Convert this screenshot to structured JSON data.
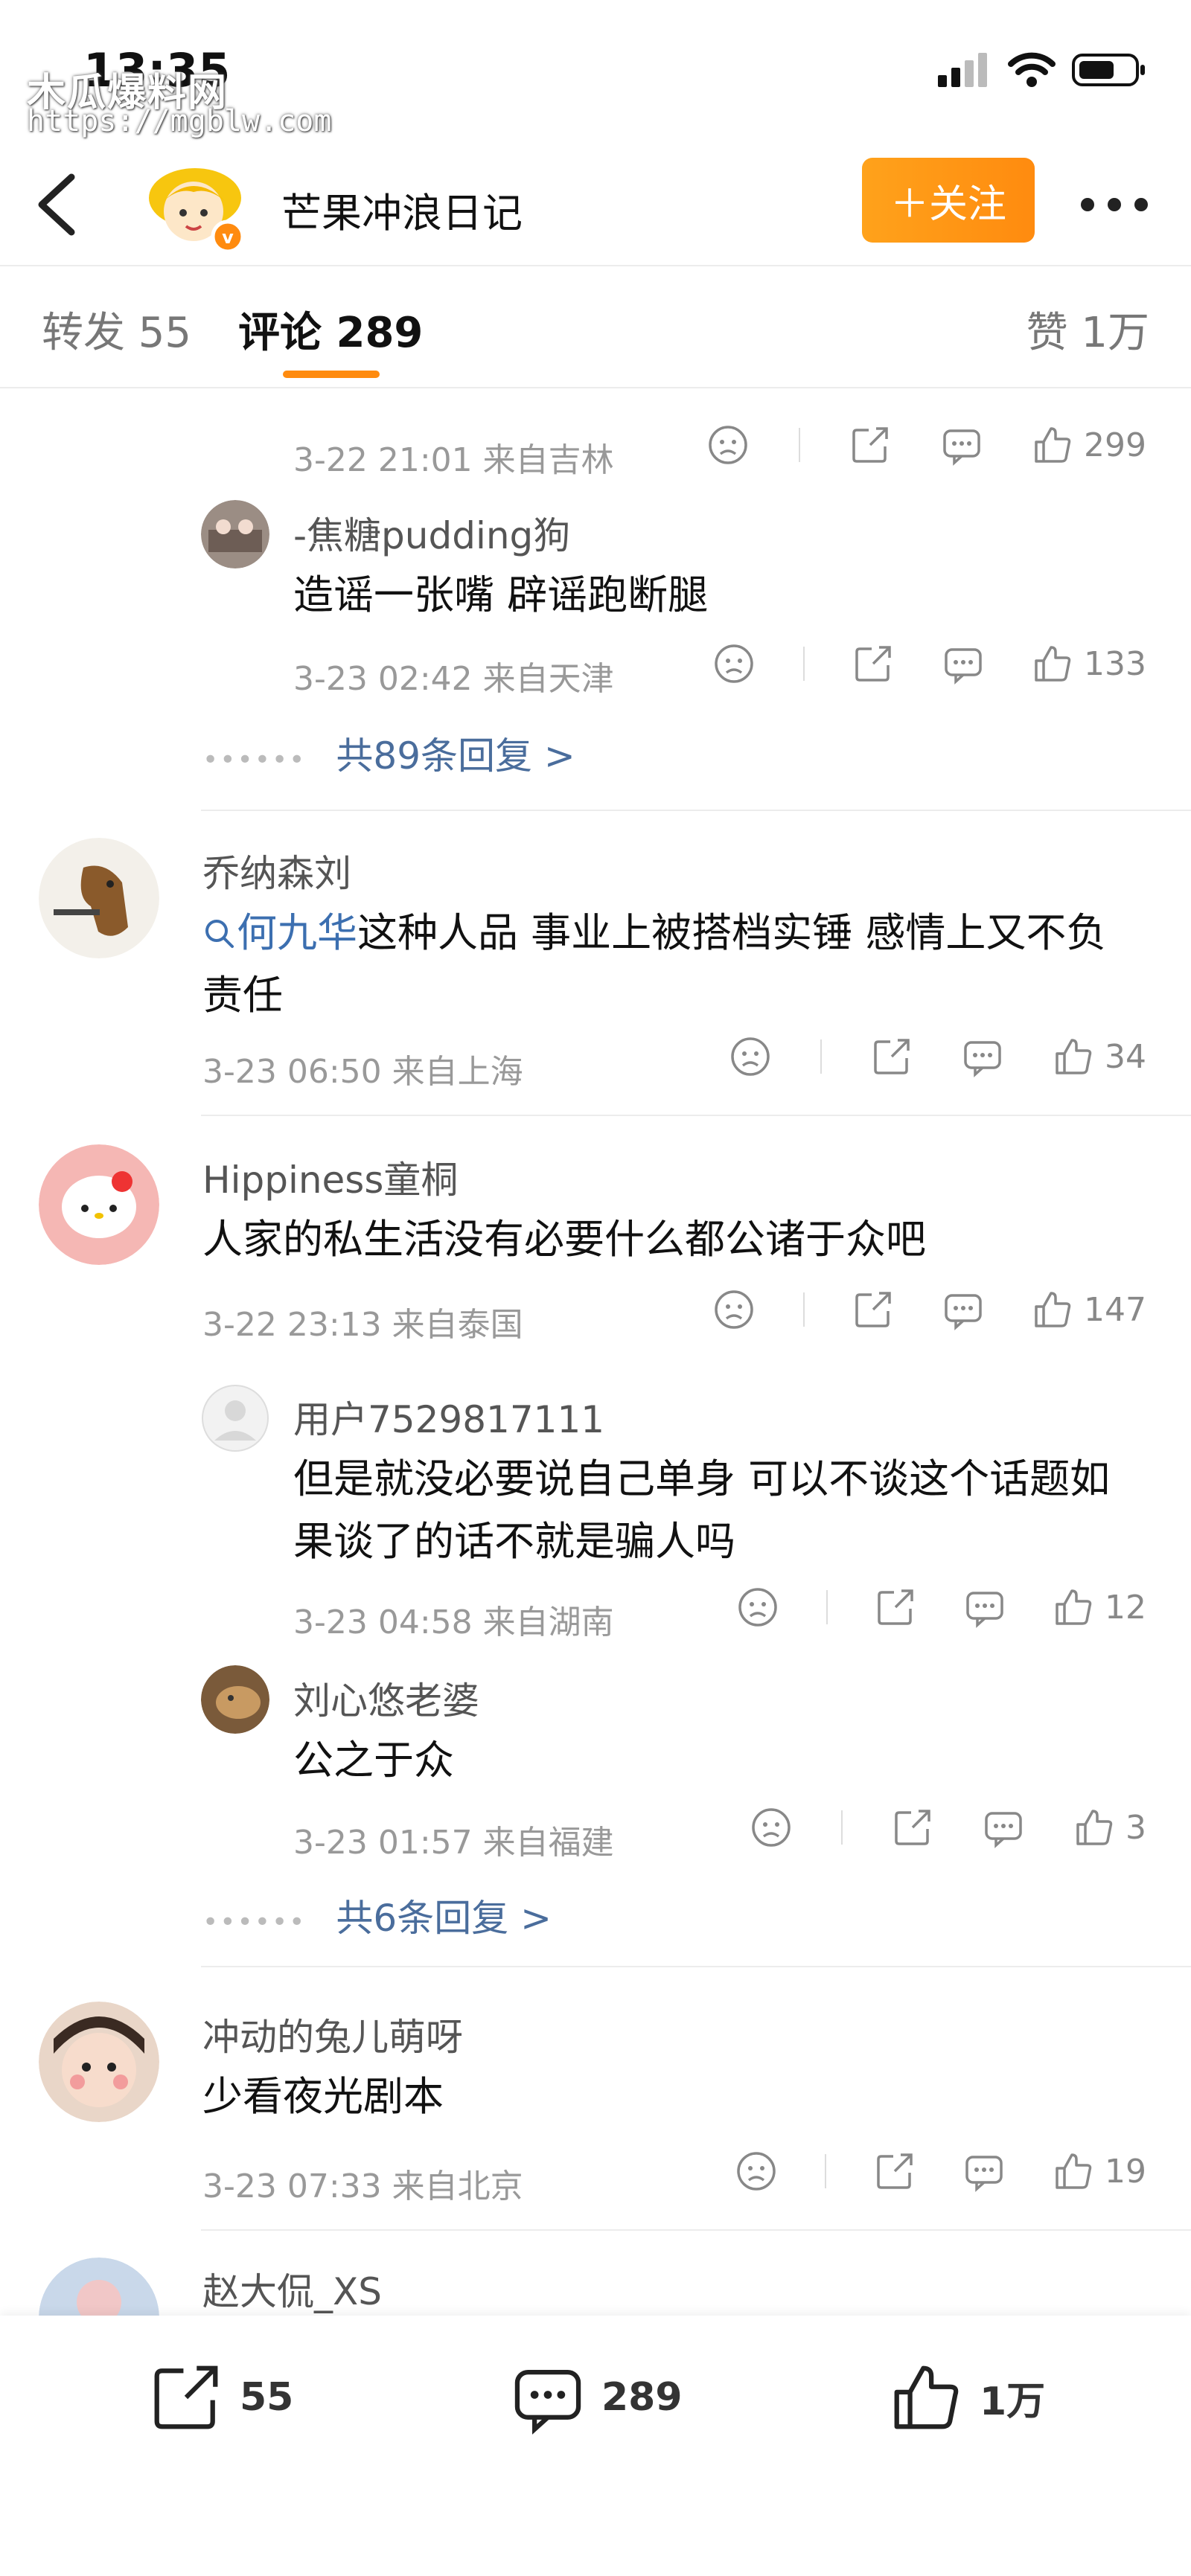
{
  "status_bar": {
    "time": "13:35",
    "watermark_name": "木瓜爆料网",
    "watermark_url": "https://mgblw.com"
  },
  "header": {
    "account_name": "芒果冲浪日记",
    "follow_label": "＋关注"
  },
  "tabs": {
    "repost": "转发 55",
    "comments": "评论 289",
    "likes": "赞 1万"
  },
  "comments": [
    {
      "id": "c0-reply-a",
      "meta": "3-22 21:01 来自吉林",
      "likes": "299"
    },
    {
      "id": "c0-reply-b",
      "name": "-焦糖pudding狗",
      "text": "造谣一张嘴 辟谣跑断腿",
      "meta": "3-23 02:42 来自天津",
      "likes": "133"
    },
    {
      "id": "c0-more",
      "more_replies": "共89条回复 >"
    },
    {
      "id": "c1",
      "name": "乔纳森刘",
      "topic": "何九华",
      "text": "这种人品 事业上被搭档实锤 感情上又不负责任",
      "meta": "3-23 06:50 来自上海",
      "likes": "34"
    },
    {
      "id": "c2",
      "name": "Hippiness童桐",
      "text": "人家的私生活没有必要什么都公诸于众吧",
      "meta": "3-22 23:13 来自泰国",
      "likes": "147"
    },
    {
      "id": "c2-reply-a",
      "name": "用户7529817111",
      "text": "但是就没必要说自己单身 可以不谈这个话题如果谈了的话不就是骗人吗",
      "meta": "3-23 04:58 来自湖南",
      "likes": "12"
    },
    {
      "id": "c2-reply-b",
      "name": "刘心悠老婆",
      "text": "公之于众",
      "meta": "3-23 01:57 来自福建",
      "likes": "3"
    },
    {
      "id": "c2-more",
      "more_replies": "共6条回复 >"
    },
    {
      "id": "c3",
      "name": "冲动的兔儿萌呀",
      "text": "少看夜光剧本",
      "meta": "3-23 07:33 来自北京",
      "likes": "19"
    },
    {
      "id": "c4",
      "name": "赵大侃_XS"
    }
  ],
  "bottom_bar": {
    "repost_count": "55",
    "comment_count": "289",
    "like_count": "1万"
  },
  "colors": {
    "accent_orange": "#ff8b0f",
    "link_blue": "#4a6d9c"
  }
}
